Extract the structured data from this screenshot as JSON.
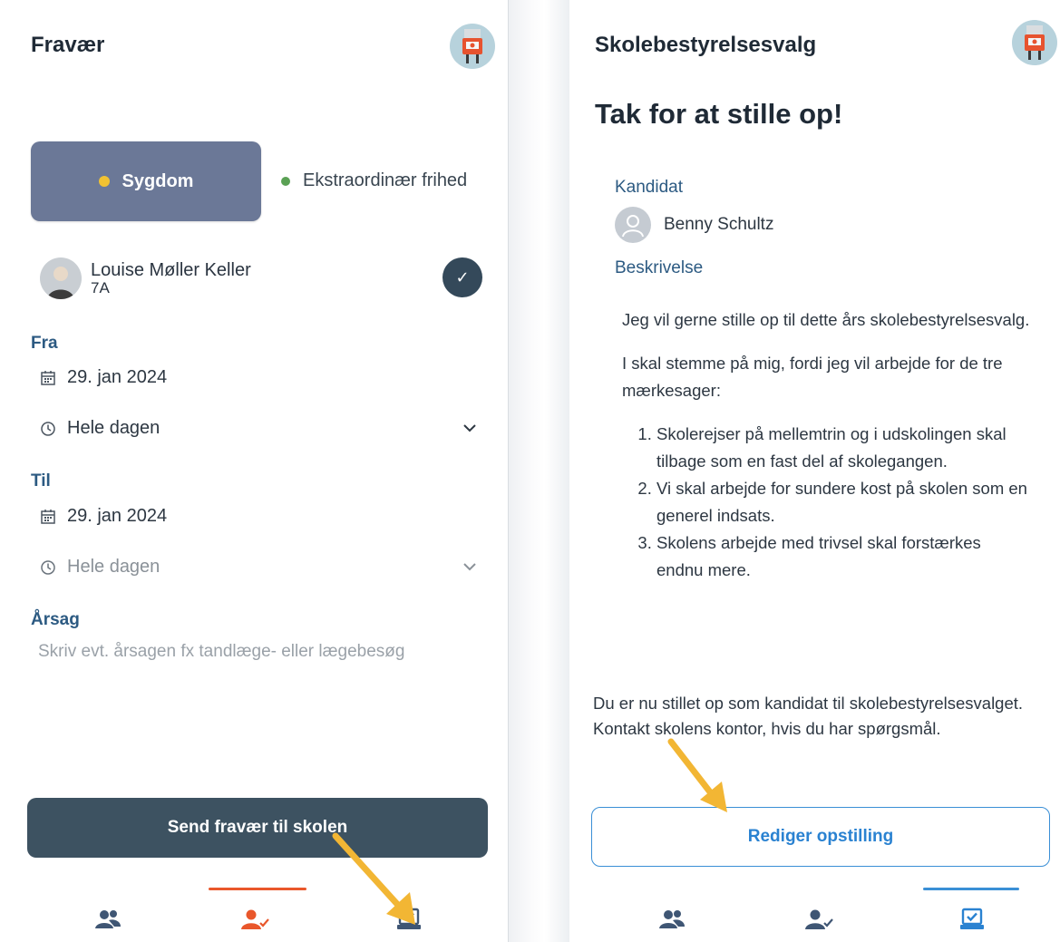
{
  "colors": {
    "accent_blue": "#2c5a82",
    "active_tab_orange": "#e9572b",
    "active_tab_blue": "#3a8fd6",
    "nav_icon": "#3f5674",
    "sygdom_dot": "#f1c232",
    "frihed_dot": "#5aa154",
    "arrow": "#f2b634"
  },
  "left": {
    "title": "Fravær",
    "reason_selected": "Sygdom",
    "reason_other": "Ekstraordinær frihed",
    "student": {
      "name": "Louise Møller Keller",
      "class": "7A"
    },
    "from": {
      "label": "Fra",
      "date": "29. jan 2024",
      "time": "Hele dagen"
    },
    "to": {
      "label": "Til",
      "date": "29. jan 2024",
      "time": "Hele dagen"
    },
    "reason": {
      "label": "Årsag",
      "placeholder": "Skriv evt. årsagen fx tandlæge- eller lægebesøg"
    },
    "submit_label": "Send fravær til skolen",
    "nav": {
      "icons": [
        "people-icon",
        "person-check-icon",
        "ballot-box-icon"
      ],
      "active": "person-check-icon"
    }
  },
  "right": {
    "title": "Skolebestyrelsesvalg",
    "heading": "Tak for at stille op!",
    "candidate_label": "Kandidat",
    "candidate_name": "Benny Schultz",
    "description_label": "Beskrivelse",
    "description": {
      "p1": "Jeg vil gerne stille op til dette års skolebestyrelsesvalg.",
      "p2": "I skal stemme på mig, fordi jeg vil arbejde for de tre mærkesager:",
      "items": [
        "Skolerejser på mellemtrin og i udskolingen skal tilbage som en fast del af skolegangen.",
        "Vi skal arbejde for sundere kost på skolen som en generel indsats.",
        "Skolens arbejde med trivsel skal forstærkes endnu mere."
      ]
    },
    "notice": "Du er nu stillet op som kandidat til skolebestyrelsesvalget. Kontakt skolens kontor, hvis du har spørgsmål.",
    "edit_label": "Rediger opstilling",
    "nav": {
      "icons": [
        "people-icon",
        "person-check-icon",
        "ballot-box-icon"
      ],
      "active": "ballot-box-icon"
    }
  }
}
